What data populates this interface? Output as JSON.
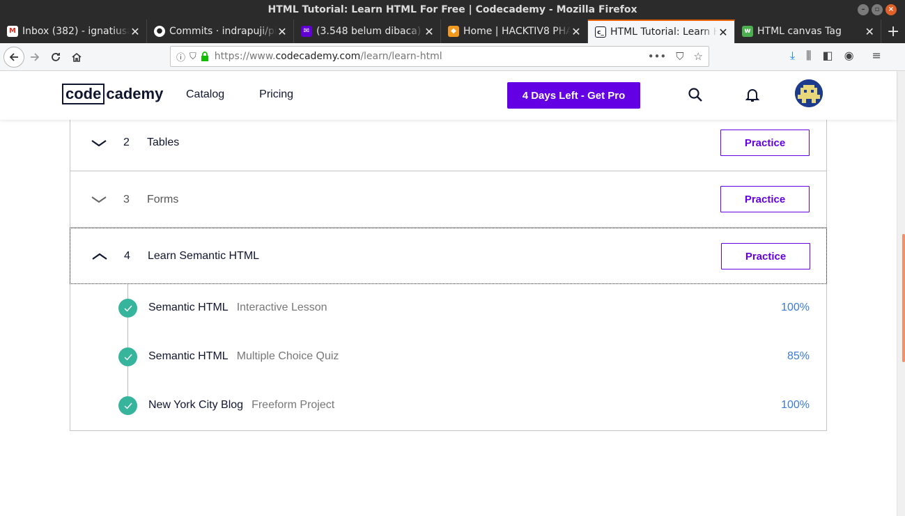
{
  "window": {
    "title": "HTML Tutorial: Learn HTML For Free | Codecademy - Mozilla Firefox"
  },
  "tabs": [
    {
      "label": "Inbox (382) - ignatiusac",
      "icon": "gmail-icon",
      "active": false
    },
    {
      "label": "Commits · indrapuji/pi",
      "icon": "github-icon",
      "active": false
    },
    {
      "label": "(3.548 belum dibaca) -",
      "icon": "yahoo-mail-icon",
      "active": false
    },
    {
      "label": "Home | HACKTIV8 PHA",
      "icon": "hacktiv8-icon",
      "active": false
    },
    {
      "label": "HTML Tutorial: Learn H",
      "icon": "codecademy-icon",
      "active": true
    },
    {
      "label": "HTML canvas Tag",
      "icon": "w3schools-icon",
      "active": false
    }
  ],
  "browser": {
    "url_prefix": "https://www.",
    "url_host": "codecademy.com",
    "url_path": "/learn/learn-html",
    "more_glyph": "•••"
  },
  "site": {
    "logo_boxed": "code",
    "logo_rest": "cademy",
    "nav": [
      "Catalog",
      "Pricing"
    ],
    "pro_button": "4 Days Left - Get Pro"
  },
  "modules": [
    {
      "number": "2",
      "title": "Tables",
      "practice": "Practice",
      "expanded": false
    },
    {
      "number": "3",
      "title": "Forms",
      "practice": "Practice",
      "expanded": false
    },
    {
      "number": "4",
      "title": "Learn Semantic HTML",
      "practice": "Practice",
      "expanded": true
    }
  ],
  "lessons": [
    {
      "title": "Semantic HTML",
      "type": "Interactive Lesson",
      "progress": "100%"
    },
    {
      "title": "Semantic HTML",
      "type": "Multiple Choice Quiz",
      "progress": "85%"
    },
    {
      "title": "New York City Blog",
      "type": "Freeform Project",
      "progress": "100%"
    }
  ],
  "colors": {
    "brand_purple": "#6400e4",
    "check_teal": "#37b49c",
    "progress_blue": "#3a7bd5",
    "firefox_orange": "#e66000"
  }
}
